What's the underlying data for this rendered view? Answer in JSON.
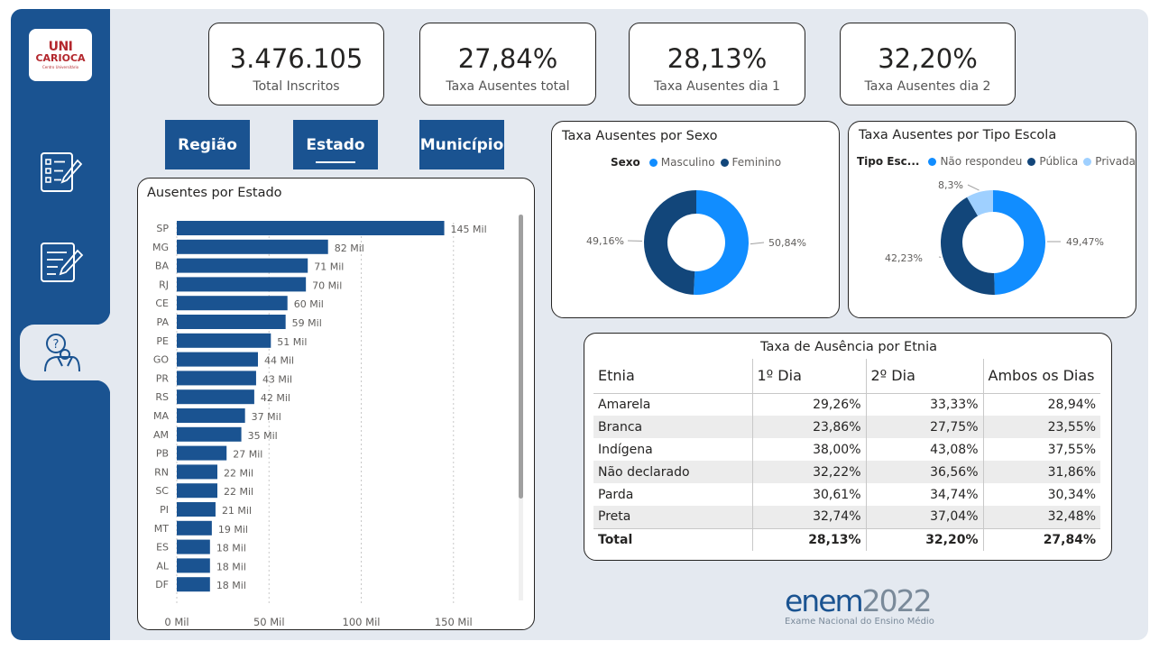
{
  "logo": {
    "line1": "UNI",
    "line2": "CARIOCA",
    "line3": "Centro Universitário"
  },
  "nav": [
    {
      "icon": "checklist-icon"
    },
    {
      "icon": "edit-document-icon"
    },
    {
      "icon": "person-question-icon",
      "active": true
    }
  ],
  "kpis": [
    {
      "value": "3.476.105",
      "label": "Total Inscritos"
    },
    {
      "value": "27,84%",
      "label": "Taxa Ausentes total"
    },
    {
      "value": "28,13%",
      "label": "Taxa Ausentes dia 1"
    },
    {
      "value": "32,20%",
      "label": "Taxa Ausentes dia 2"
    }
  ],
  "tabs": [
    {
      "label": "Região"
    },
    {
      "label": "Estado",
      "active": true
    },
    {
      "label": "Município"
    }
  ],
  "colors": {
    "primary": "#1a5391",
    "light_blue": "#118dff",
    "pale_blue": "#9fd0ff",
    "bar": "#1a5391"
  },
  "chart_data": [
    {
      "type": "bar",
      "orientation": "horizontal",
      "title": "Ausentes por Estado",
      "categories": [
        "SP",
        "MG",
        "BA",
        "RJ",
        "CE",
        "PA",
        "PE",
        "GO",
        "PR",
        "RS",
        "MA",
        "AM",
        "PB",
        "RN",
        "SC",
        "PI",
        "MT",
        "ES",
        "AL",
        "DF"
      ],
      "values": [
        145000,
        82000,
        71000,
        70000,
        60000,
        59000,
        51000,
        44000,
        43000,
        42000,
        37000,
        35000,
        27000,
        22000,
        22000,
        21000,
        19000,
        18000,
        18000,
        18000
      ],
      "data_labels": [
        "145 Mil",
        "82 Mil",
        "71 Mil",
        "70 Mil",
        "60 Mil",
        "59 Mil",
        "51 Mil",
        "44 Mil",
        "43 Mil",
        "42 Mil",
        "37 Mil",
        "35 Mil",
        "27 Mil",
        "22 Mil",
        "22 Mil",
        "21 Mil",
        "19 Mil",
        "18 Mil",
        "18 Mil",
        "18 Mil"
      ],
      "xticks": [
        "0 Mil",
        "50 Mil",
        "100 Mil",
        "150 Mil"
      ],
      "xtick_values": [
        0,
        50000,
        100000,
        150000
      ],
      "xlim": [
        0,
        155000
      ],
      "grid": true
    },
    {
      "type": "pie",
      "variant": "donut",
      "title": "Taxa Ausentes por Sexo",
      "legend_title": "Sexo",
      "legend_position": "top",
      "series": [
        {
          "name": "Masculino",
          "value": 50.84,
          "label": "50,84%",
          "color": "#118dff"
        },
        {
          "name": "Feminino",
          "value": 49.16,
          "label": "49,16%",
          "color": "#12467a"
        }
      ]
    },
    {
      "type": "pie",
      "variant": "donut",
      "title": "Taxa Ausentes por Tipo Escola",
      "legend_title": "Tipo Esc...",
      "legend_position": "top",
      "series": [
        {
          "name": "Não respondeu",
          "value": 49.47,
          "label": "49,47%",
          "color": "#118dff"
        },
        {
          "name": "Pública",
          "value": 42.23,
          "label": "42,23%",
          "color": "#12467a"
        },
        {
          "name": "Privada",
          "value": 8.3,
          "label": "8,3%",
          "color": "#9fd0ff"
        }
      ]
    }
  ],
  "etnia_table": {
    "title": "Taxa de Ausência por Etnia",
    "headers": [
      "Etnia",
      "1º Dia",
      "2º Dia",
      "Ambos os Dias"
    ],
    "rows": [
      [
        "Amarela",
        "29,26%",
        "33,33%",
        "28,94%"
      ],
      [
        "Branca",
        "23,86%",
        "27,75%",
        "23,55%"
      ],
      [
        "Indígena",
        "38,00%",
        "43,08%",
        "37,55%"
      ],
      [
        "Não declarado",
        "32,22%",
        "36,56%",
        "31,86%"
      ],
      [
        "Parda",
        "30,61%",
        "34,74%",
        "30,34%"
      ],
      [
        "Preta",
        "32,74%",
        "37,04%",
        "32,48%"
      ]
    ],
    "total": [
      "Total",
      "28,13%",
      "32,20%",
      "27,84%"
    ]
  },
  "brand": {
    "word": "enem",
    "year": "2022",
    "subtitle": "Exame Nacional do Ensino Médio"
  }
}
